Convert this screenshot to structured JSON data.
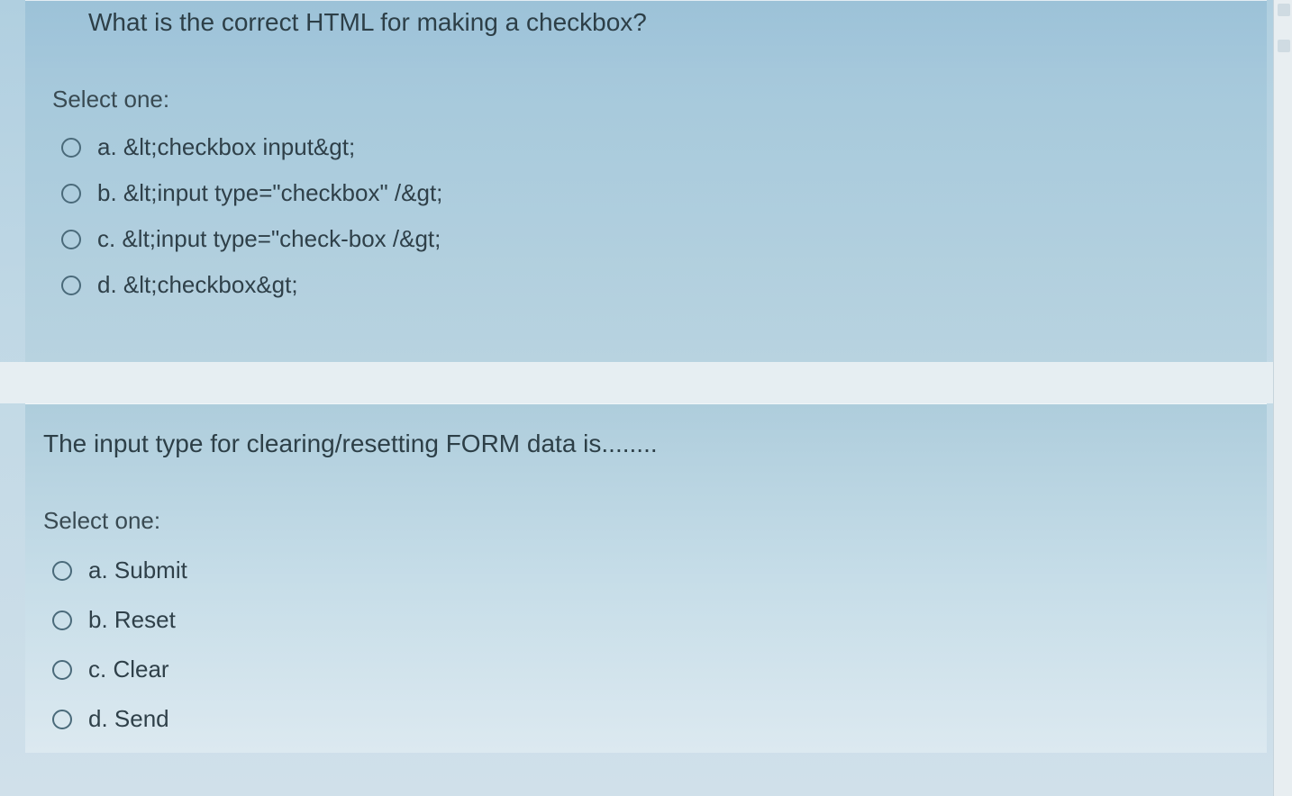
{
  "q1": {
    "question": "What is the correct HTML for making a checkbox?",
    "prompt": "Select one:",
    "options": {
      "a": "a. &lt;checkbox input&gt;",
      "b": "b. &lt;input type=\"checkbox\" /&gt;",
      "c": "c. &lt;input type=\"check-box /&gt;",
      "d": "d. &lt;checkbox&gt;"
    }
  },
  "q2": {
    "question": "The input type for clearing/resetting FORM data is........",
    "prompt": "Select one:",
    "options": {
      "a": "a. Submit",
      "b": "b. Reset",
      "c": "c. Clear",
      "d": "d. Send"
    }
  }
}
